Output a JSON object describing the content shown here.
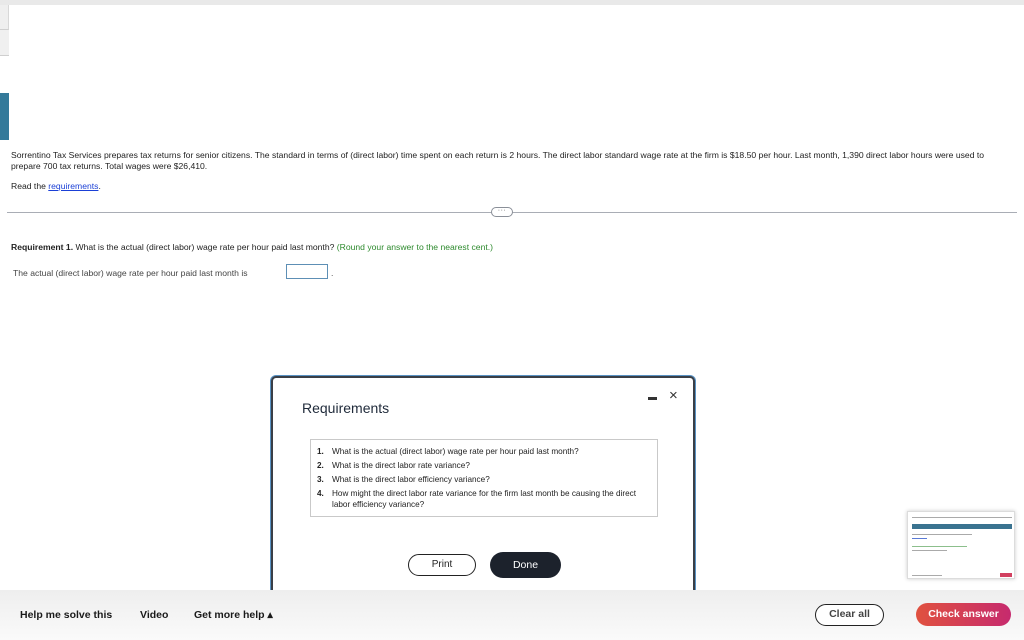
{
  "problem": {
    "text": "Sorrentino Tax Services prepares tax returns for senior citizens. The standard in terms of (direct labor) time spent on each return is 2 hours. The direct labor standard wage rate at the firm is $18.50 per hour. Last month, 1,390 direct labor hours were used to prepare 700 tax returns. Total wages were $26,410.",
    "read_prefix": "Read the ",
    "read_link": "requirements",
    "read_suffix": "."
  },
  "divider": {
    "more_label": "···"
  },
  "requirement1": {
    "label": "Requirement 1.",
    "question": " What is the actual (direct labor) wage rate per hour paid last month? ",
    "hint": "(Round your answer to the nearest cent.)",
    "answer_prefix": "The actual (direct labor) wage rate per hour paid last month is",
    "answer_value": "",
    "answer_suffix": "."
  },
  "modal": {
    "title": "Requirements",
    "minimize_icon": "minimize-icon",
    "close_icon": "×",
    "items": [
      {
        "num": "1.",
        "text": "What is the actual (direct labor) wage rate per hour paid last month?"
      },
      {
        "num": "2.",
        "text": "What is the direct labor rate variance?"
      },
      {
        "num": "3.",
        "text": "What is the direct labor efficiency variance?"
      },
      {
        "num": "4.",
        "text": "How might the direct labor rate variance for the firm last month be causing the direct labor efficiency variance?"
      }
    ],
    "print_label": "Print",
    "done_label": "Done"
  },
  "footer": {
    "help_solve": "Help me solve this",
    "video": "Video",
    "more_help": "Get more help ▴",
    "clear_all": "Clear all",
    "check_answer": "Check answer"
  }
}
